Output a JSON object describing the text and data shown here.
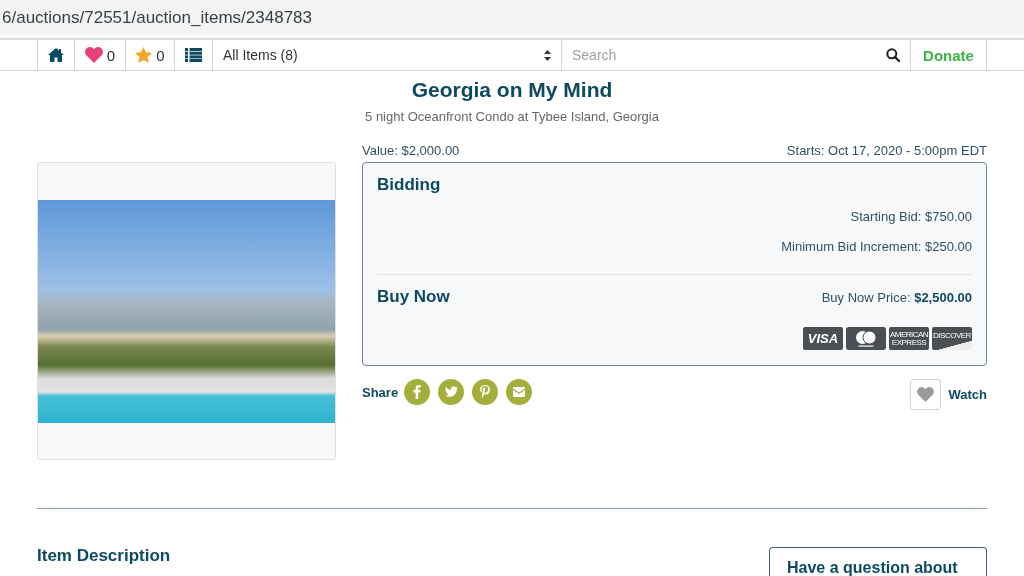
{
  "browser": {
    "url": "6/auctions/72551/auction_items/2348783"
  },
  "navbar": {
    "items": [
      {
        "kind": "home"
      },
      {
        "kind": "favorites",
        "count": "0"
      },
      {
        "kind": "starred",
        "count": "0"
      },
      {
        "kind": "list"
      }
    ],
    "category_select": {
      "value": "All Items (8)"
    },
    "search": {
      "placeholder": "Search"
    },
    "donate": "Donate"
  },
  "item": {
    "title": "Georgia on My Mind",
    "subtitle": "5 night Oceanfront Condo at Tybee Island, Georgia",
    "value": "Value: $2,000.00",
    "starts": "Starts: Oct 17, 2020 - 5:00pm EDT"
  },
  "bidding": {
    "heading": "Bidding",
    "lines": [
      "Starting Bid: $750.00",
      "Minimum Bid Increment: $250.00"
    ]
  },
  "buy_now": {
    "heading": "Buy Now",
    "price": "Buy Now Price: **$2,500.00**",
    "cards": [
      {
        "kind": "visa",
        "label": "VISA"
      },
      {
        "kind": "mastercard"
      },
      {
        "kind": "amex",
        "label": "AMERICAN EXPRESS"
      },
      {
        "kind": "discover",
        "label": "DISCOVER"
      }
    ]
  },
  "share": {
    "label": "Share",
    "networks": [
      {
        "kind": "facebook"
      },
      {
        "kind": "twitter"
      },
      {
        "kind": "pinterest"
      },
      {
        "kind": "email"
      }
    ]
  },
  "watch": {
    "label": "Watch",
    "watched": false
  },
  "description": {
    "heading": "Item Description"
  },
  "question": {
    "heading": "Have a question about"
  }
}
